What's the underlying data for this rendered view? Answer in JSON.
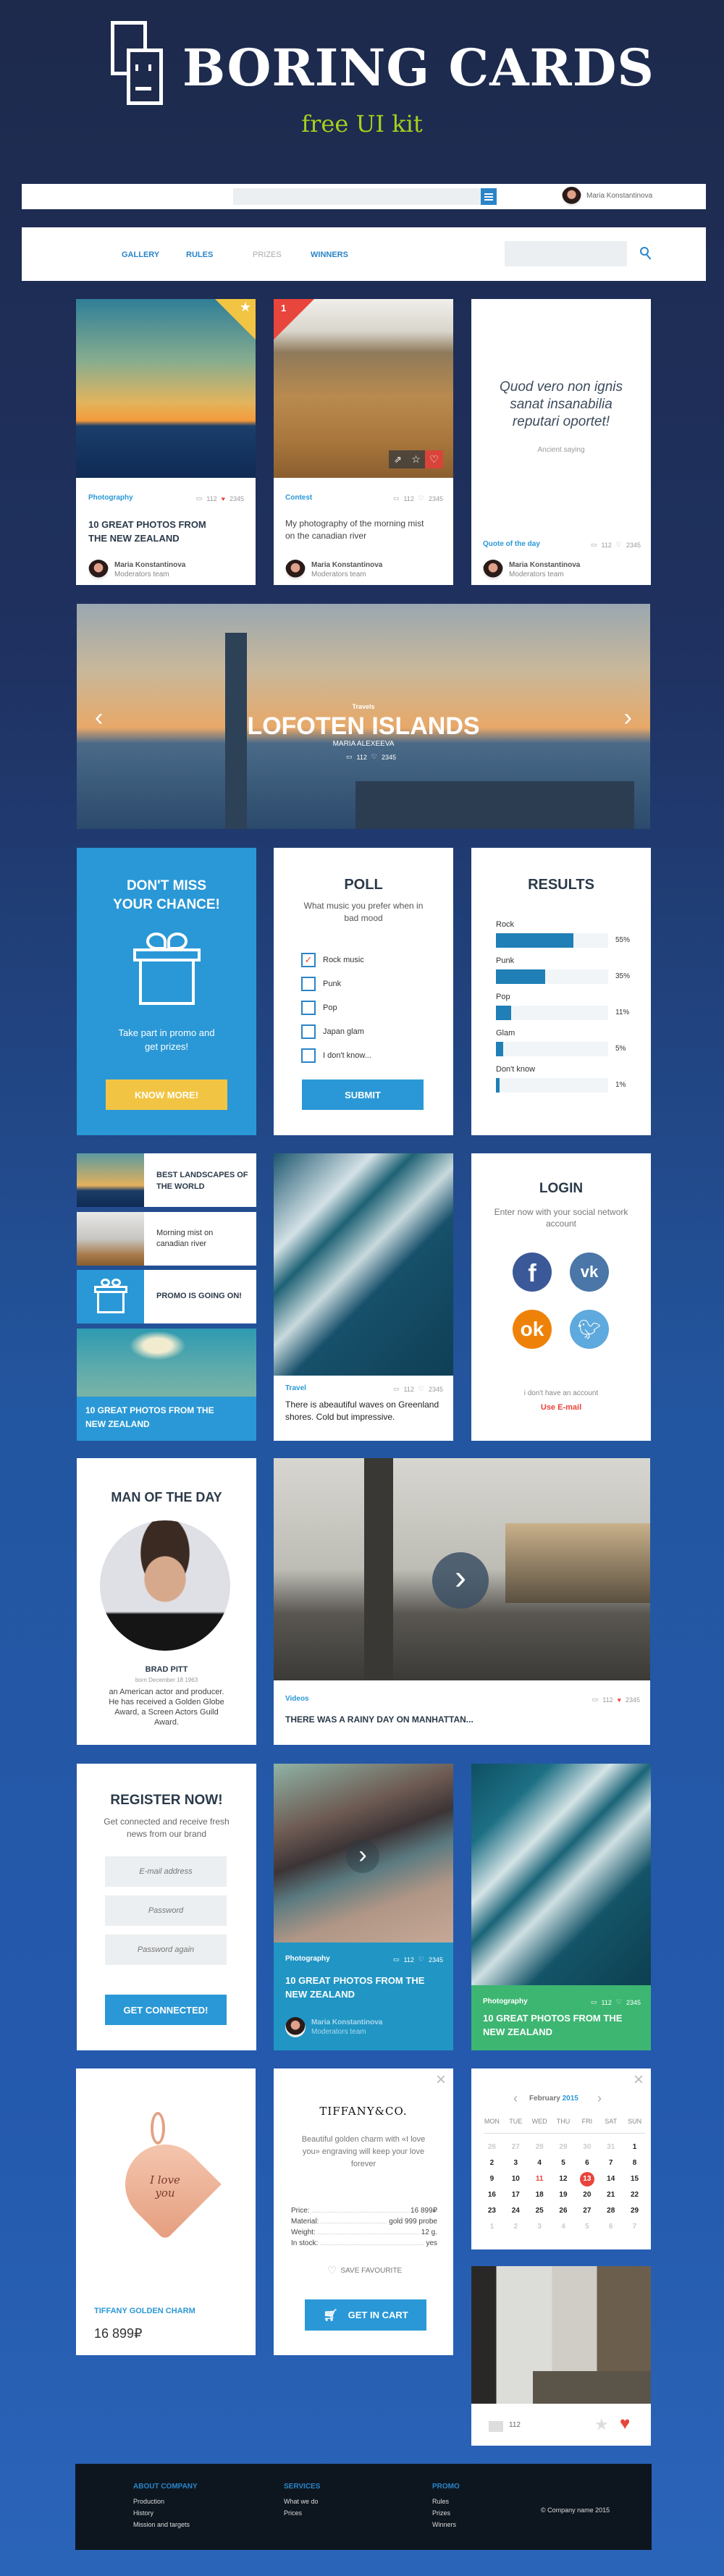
{
  "brand": {
    "title": "BORING CARDS",
    "subtitle": "free UI kit",
    "accent": "#a8d01c"
  },
  "topbar": {
    "user_name": "Maria Konstantinova",
    "menu_icon": "hamburger-icon",
    "search_value": ""
  },
  "nav": {
    "items": [
      {
        "label": "GALLERY"
      },
      {
        "label": "RULES"
      },
      {
        "label": "PRIZES",
        "muted": true
      },
      {
        "label": "WINNERS"
      }
    ],
    "search_value": "",
    "search_icon": "search-icon"
  },
  "author": {
    "name": "Maria Konstantinova",
    "role": "Moderators team"
  },
  "stats": {
    "comments": "112",
    "likes": "2345"
  },
  "row1": {
    "card1": {
      "category": "Photography",
      "title": "10 GREAT PHOTOS FROM THE NEW ZEALAND",
      "badge_icon": "star-icon"
    },
    "card2": {
      "badge": "1",
      "category": "Contest",
      "text": "My photography of the morning mist on the canadian river",
      "actions": [
        "share-icon",
        "star-icon",
        "heart-icon"
      ]
    },
    "card3": {
      "quote": "Quod vero non ignis sanat insanabilia reputari oportet!",
      "source": "Ancient saying",
      "category": "Quote of the day"
    }
  },
  "hero": {
    "category": "Travels",
    "title": "LOFOTEN ISLANDS",
    "author": "MARIA ALEXEEVA"
  },
  "promo": {
    "title": "DON'T MISS YOUR CHANCE!",
    "text": "Take part in promo and get prizes!",
    "button": "KNOW MORE!"
  },
  "poll": {
    "title": "POLL",
    "question": "What music you prefer when in bad mood",
    "options": [
      {
        "label": "Rock music",
        "checked": true
      },
      {
        "label": "Punk",
        "checked": false
      },
      {
        "label": "Pop",
        "checked": false
      },
      {
        "label": "Japan glam",
        "checked": false
      },
      {
        "label": "I don't know...",
        "checked": false
      }
    ],
    "button": "SUBMIT"
  },
  "results": {
    "title": "RESULTS",
    "items": [
      {
        "label": "Rock",
        "value": 55,
        "text": "55%"
      },
      {
        "label": "Punk",
        "value": 35,
        "text": "35%"
      },
      {
        "label": "Pop",
        "value": 11,
        "text": "11%"
      },
      {
        "label": "Glam",
        "value": 5,
        "text": "5%"
      },
      {
        "label": "Don't know",
        "value": 1,
        "text": "1%"
      }
    ]
  },
  "mini_list": {
    "item1": "BEST LANDSCAPES OF THE WORLD",
    "item2": "Morning mist on canadian river",
    "item3": "PROMO IS GOING ON!",
    "item4": "10 GREAT PHOTOS FROM THE NEW ZEALAND"
  },
  "wave_card": {
    "category": "Travel",
    "text": "There is abeautiful waves on Greenland shores. Cold but impressive."
  },
  "login": {
    "title": "LOGIN",
    "text": "Enter now with your social network account",
    "socials": [
      "facebook-icon",
      "vk-icon",
      "odnoklassniki-icon",
      "twitter-icon"
    ],
    "no_account": "i don't have an account",
    "email_link": "Use E-mail"
  },
  "man": {
    "title": "MAN OF THE DAY",
    "name": "BRAD PITT",
    "born": "born December 18 1963",
    "bio": "an American actor and producer. He has received a Golden Globe Award, a Screen Actors Guild Award."
  },
  "video": {
    "category": "Videos",
    "title": "THERE WAS A RAINY DAY ON MANHATTAN..."
  },
  "register": {
    "title": "REGISTER NOW!",
    "text": "Get connected and receive fresh news from our brand",
    "email_placeholder": "E-mail address",
    "password_placeholder": "Password",
    "password2_placeholder": "Password again",
    "button": "GET CONNECTED!"
  },
  "beach": {
    "category": "Photography",
    "title": "10 GREAT PHOTOS FROM THE NEW ZEALAND"
  },
  "green": {
    "category": "Photography",
    "title": "10 GREAT PHOTOS FROM THE NEW ZEALAND"
  },
  "product": {
    "name": "TIFFANY GOLDEN CHARM",
    "price": "16 899₽",
    "engraving": "I love you"
  },
  "detail": {
    "brand": "TIFFANY&CO.",
    "text": "Beautiful golden charm with «I love you» engraving will keep your love forever",
    "specs": [
      {
        "k": "Price:",
        "v": "16 899₽"
      },
      {
        "k": "Material:",
        "v": "gold 999 probe"
      },
      {
        "k": "Weight:",
        "v": "12 g."
      },
      {
        "k": "In stock:",
        "v": "yes"
      }
    ],
    "save": "SAVE FAVOURITE",
    "button": "GET IN CART"
  },
  "calendar": {
    "month": "February",
    "year": "2015",
    "weekdays": [
      "MON",
      "TUE",
      "WED",
      "THU",
      "FRI",
      "SAT",
      "SUN"
    ],
    "weeks": [
      [
        "26",
        "27",
        "28",
        "29",
        "30",
        "31",
        "1"
      ],
      [
        "2",
        "3",
        "4",
        "5",
        "6",
        "7",
        "8"
      ],
      [
        "9",
        "10",
        "11",
        "12",
        "13",
        "14",
        "15"
      ],
      [
        "16",
        "17",
        "18",
        "19",
        "20",
        "21",
        "22"
      ],
      [
        "23",
        "24",
        "25",
        "26",
        "27",
        "28",
        "29"
      ],
      [
        "1",
        "2",
        "3",
        "4",
        "5",
        "6",
        "7"
      ]
    ],
    "selected": "13",
    "highlighted": "11"
  },
  "photo_small": {
    "comments": "112"
  },
  "footer": {
    "cols": [
      {
        "title": "ABOUT COMPANY",
        "links": [
          "Production",
          "History",
          "Mission and targets"
        ]
      },
      {
        "title": "SERVICES",
        "links": [
          "What we do",
          "Prices"
        ]
      },
      {
        "title": "PROMO",
        "links": [
          "Rules",
          "Prizes",
          "Winners"
        ]
      }
    ],
    "copyright": "© Company name 2015"
  },
  "colors": {
    "blue": "#2a98d6",
    "yellow": "#f2c443",
    "red": "#e8453c",
    "green": "#3db671",
    "teal": "#2196c4",
    "footer": "#0d161f"
  }
}
